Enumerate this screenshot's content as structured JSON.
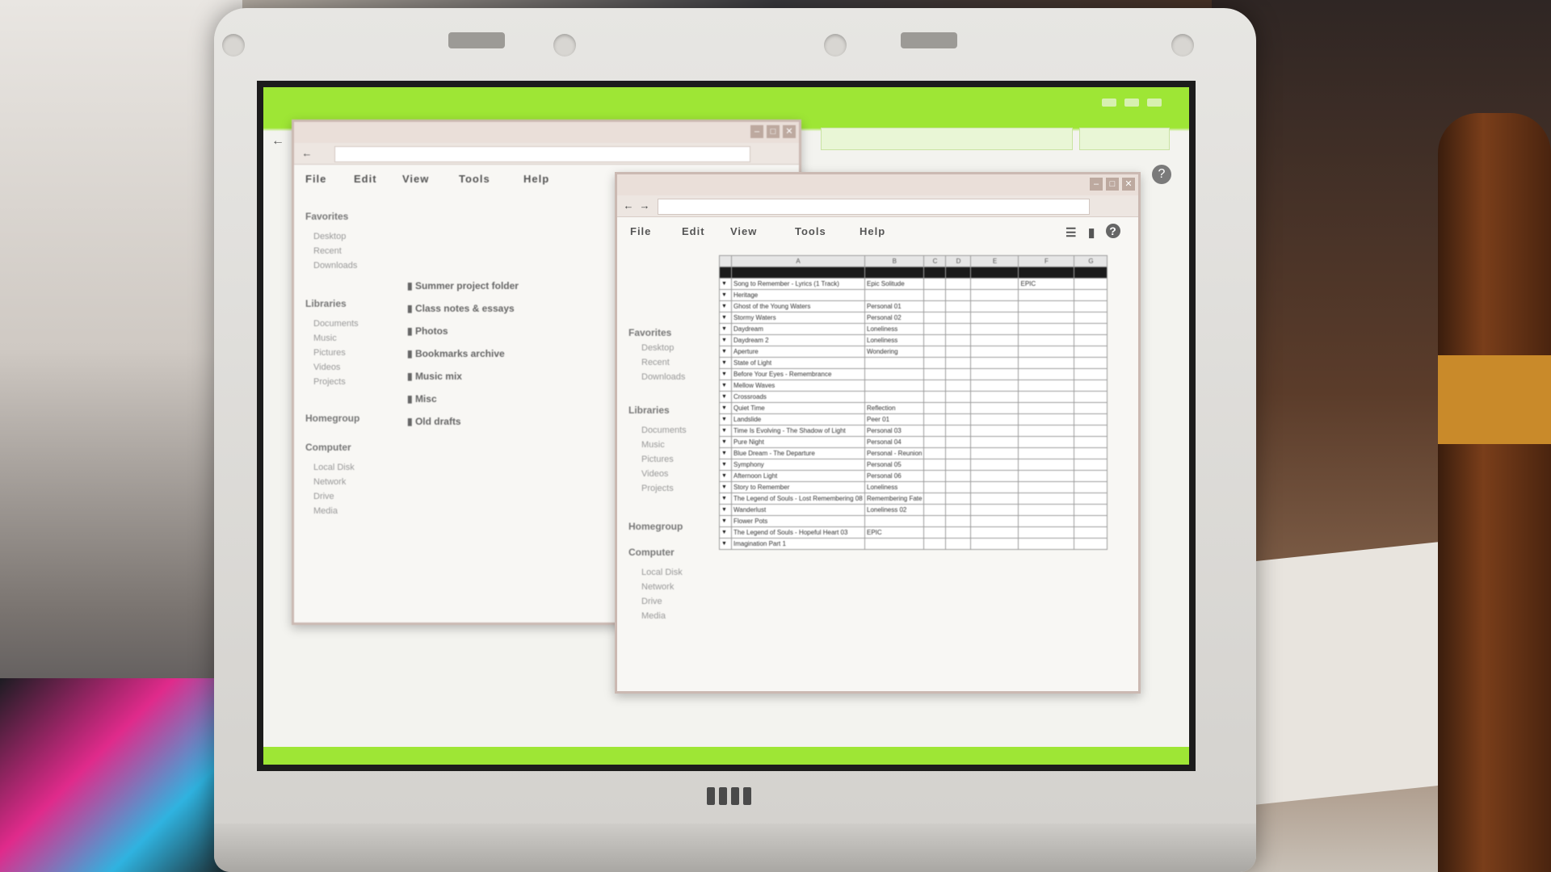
{
  "desktop": {
    "back_glyph": "←"
  },
  "window_back": {
    "controls": [
      "–",
      "□",
      "✕"
    ],
    "nav_back": "←",
    "menu": [
      "File",
      "Edit",
      "View",
      "Tools",
      "Help"
    ],
    "sidebar_groups": [
      {
        "title": "Favorites",
        "items": [
          "Desktop",
          "Recent",
          "Downloads"
        ]
      },
      {
        "title": "Libraries",
        "items": [
          "Documents",
          "Music",
          "Pictures",
          "Videos",
          "Projects"
        ]
      },
      {
        "title": "Homegroup",
        "items": []
      },
      {
        "title": "Computer",
        "items": [
          "Local Disk",
          "Network",
          "Drive",
          "Media"
        ]
      }
    ],
    "files": [
      "Summer project folder",
      "Class notes & essays",
      "Photos",
      "Bookmarks archive",
      "Music mix",
      "Misc",
      "Old drafts"
    ]
  },
  "window_front": {
    "controls": [
      "–",
      "□",
      "✕"
    ],
    "nav_back": "←",
    "nav_forward": "→",
    "menu": [
      "File",
      "Edit",
      "View",
      "Tools",
      "Help"
    ],
    "view_icon": "☰",
    "panel_icon": "▮",
    "help_icon": "?",
    "sidebar_groups": [
      {
        "title": "Favorites",
        "items": [
          "Desktop",
          "Recent",
          "Downloads"
        ]
      },
      {
        "title": "Libraries",
        "items": [
          "Documents",
          "Music",
          "Pictures",
          "Videos",
          "Projects"
        ]
      },
      {
        "title": "Homegroup",
        "items": []
      },
      {
        "title": "Computer",
        "items": [
          "Local Disk",
          "Network",
          "Drive",
          "Media"
        ]
      }
    ],
    "sheet_columns": [
      "A",
      "B",
      "C",
      "D",
      "E",
      "F",
      "G"
    ],
    "sheet_rows": [
      [
        "Song to Remember - Lyrics (1 Track)",
        "Epic Solitude",
        "",
        "",
        "",
        "EPIC",
        ""
      ],
      [
        "Heritage",
        "",
        "",
        "",
        "",
        "",
        ""
      ],
      [
        "Ghost of the Young Waters",
        "Personal 01",
        "",
        "",
        "",
        "",
        ""
      ],
      [
        "Stormy Waters",
        "Personal 02",
        "",
        "",
        "",
        "",
        ""
      ],
      [
        "Daydream",
        "Loneliness",
        "",
        "",
        "",
        "",
        ""
      ],
      [
        "Daydream 2",
        "Loneliness",
        "",
        "",
        "",
        "",
        ""
      ],
      [
        "Aperture",
        "Wondering",
        "",
        "",
        "",
        "",
        ""
      ],
      [
        "State of Light",
        "",
        "",
        "",
        "",
        "",
        ""
      ],
      [
        "Before Your Eyes - Remembrance",
        "",
        "",
        "",
        "",
        "",
        ""
      ],
      [
        "Mellow Waves",
        "",
        "",
        "",
        "",
        "",
        ""
      ],
      [
        "Crossroads",
        "",
        "",
        "",
        "",
        "",
        ""
      ],
      [
        "Quiet Time",
        "Reflection",
        "",
        "",
        "",
        "",
        ""
      ],
      [
        "Landslide",
        "Peer 01",
        "",
        "",
        "",
        "",
        ""
      ],
      [
        "Time Is Evolving - The Shadow of Light",
        "Personal 03",
        "",
        "",
        "",
        "",
        ""
      ],
      [
        "Pure Night",
        "Personal 04",
        "",
        "",
        "",
        "",
        ""
      ],
      [
        "Blue Dream - The Departure",
        "Personal - Reunion",
        "",
        "",
        "",
        "",
        ""
      ],
      [
        "Symphony",
        "Personal 05",
        "",
        "",
        "",
        "",
        ""
      ],
      [
        "Afternoon Light",
        "Personal 06",
        "",
        "",
        "",
        "",
        ""
      ],
      [
        "Story to Remember",
        "Loneliness",
        "",
        "",
        "",
        "",
        ""
      ],
      [
        "The Legend of Souls - Lost Remembering 08",
        "Remembering Fate",
        "",
        "",
        "",
        "",
        ""
      ],
      [
        "Wanderlust",
        "Loneliness 02",
        "",
        "",
        "",
        "",
        ""
      ],
      [
        "Flower Pots",
        "",
        "",
        "",
        "",
        "",
        ""
      ],
      [
        "The Legend of Souls - Hopeful Heart 03",
        "EPIC",
        "",
        "",
        "",
        "",
        ""
      ],
      [
        "Imagination Part 1",
        "",
        "",
        "",
        "",
        "",
        ""
      ]
    ]
  }
}
